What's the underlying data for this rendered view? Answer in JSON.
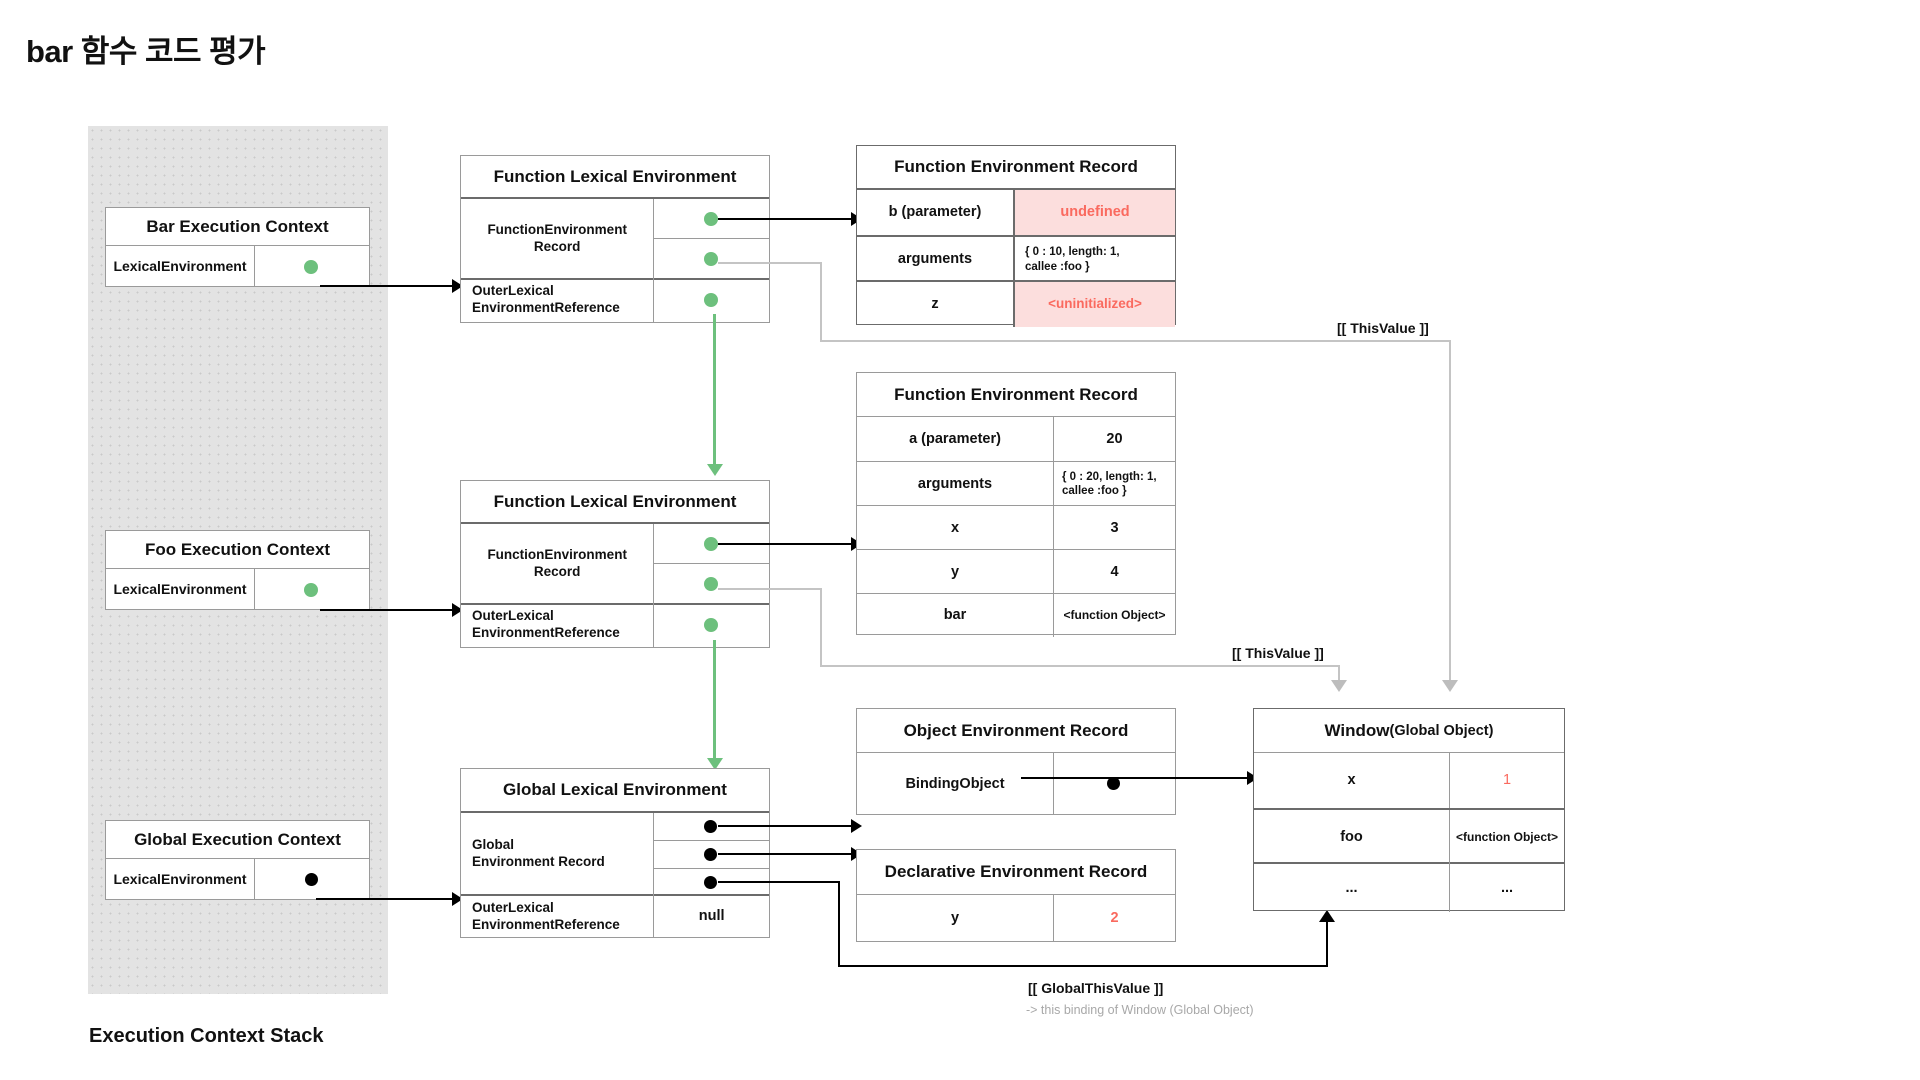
{
  "title": "bar 함수 코드 평가",
  "stack": {
    "label": "Execution Context Stack",
    "contexts": [
      {
        "title": "Bar Execution Context",
        "field": "LexicalEnvironment",
        "pointer": "green-dot"
      },
      {
        "title": "Foo Execution Context",
        "field": "LexicalEnvironment",
        "pointer": "green-dot"
      },
      {
        "title": "Global Execution Context",
        "field": "LexicalEnvironment",
        "pointer": "black-dot"
      }
    ]
  },
  "lexical_environments": {
    "bar": {
      "title": "Function Lexical Environment",
      "rows": [
        {
          "label": "FunctionEnvironment\nRecord",
          "label_line1": "FunctionEnvironment",
          "label_line2": "Record"
        },
        {
          "label_line1": "OuterLexical",
          "label_line2": "EnvironmentReference"
        }
      ]
    },
    "foo": {
      "title": "Function Lexical Environment",
      "rows": [
        {
          "label_line1": "FunctionEnvironment",
          "label_line2": "Record"
        },
        {
          "label_line1": "OuterLexical",
          "label_line2": "EnvironmentReference"
        }
      ]
    },
    "global": {
      "title": "Global Lexical Environment",
      "rows": [
        {
          "label_line1": "Global",
          "label_line2": "Environment Record"
        },
        {
          "label_line1": "OuterLexical",
          "label_line2": "EnvironmentReference",
          "value": "null"
        }
      ]
    }
  },
  "records": {
    "bar_fer": {
      "title": "Function Environment Record",
      "rows": [
        {
          "key": "b (parameter)",
          "value": "undefined",
          "value_style": "red-highlight"
        },
        {
          "key": "arguments",
          "value": "{ 0 : 10, length: 1,\ncallee :foo }",
          "value_line1": "{ 0 : 10, length: 1,",
          "value_line2": "callee :foo }",
          "value_style": "plain"
        },
        {
          "key": "z",
          "value": "<uninitialized>",
          "value_style": "red-highlight"
        }
      ]
    },
    "foo_fer": {
      "title": "Function Environment Record",
      "rows": [
        {
          "key": "a (parameter)",
          "value": "20",
          "value_style": "plain"
        },
        {
          "key": "arguments",
          "value_line1": "{ 0 : 20, length: 1,",
          "value_line2": "callee :foo }",
          "value_style": "plain"
        },
        {
          "key": "x",
          "value": "3",
          "value_style": "plain"
        },
        {
          "key": "y",
          "value": "4",
          "value_style": "plain"
        },
        {
          "key": "bar",
          "value": "<function Object>",
          "value_style": "plain"
        }
      ]
    },
    "object_env": {
      "title": "Object Environment Record",
      "rows": [
        {
          "key": "BindingObject",
          "value": "black-dot"
        }
      ]
    },
    "declarative_env": {
      "title": "Declarative Environment Record",
      "rows": [
        {
          "key": "y",
          "value": "2",
          "value_style": "red"
        }
      ]
    }
  },
  "window": {
    "title_bold": "Window",
    "title_rest": "(Global Object)",
    "rows": [
      {
        "key": "x",
        "value": "1",
        "value_style": "red"
      },
      {
        "key": "foo",
        "value": "<function Object>",
        "value_style": "plain"
      },
      {
        "key": "...",
        "value": "...",
        "value_style": "plain"
      }
    ]
  },
  "annotations": {
    "this_value_top": "[[ ThisValue ]]",
    "this_value_mid": "[[ ThisValue ]]",
    "global_this_value": "[[ GlobalThisValue ]]",
    "global_this_value_sub": "-> this binding of Window (Global Object)"
  },
  "colors": {
    "green_pointer": "#6dc07d",
    "red_text": "#fa6a5f",
    "red_bg": "#fcdedd",
    "stack_bg": "#e3e3e3",
    "border": "#9a9a9a"
  }
}
